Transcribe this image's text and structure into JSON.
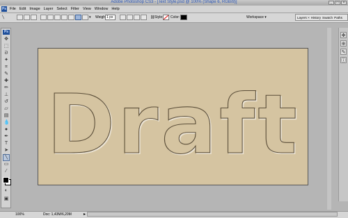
{
  "window": {
    "title": "Adobe Photoshop CS3 - [Text Style.psd @ 100% (Shape 6, RGB/8)]"
  },
  "menu": {
    "logo": "Ps",
    "items": [
      "File",
      "Edit",
      "Image",
      "Layer",
      "Select",
      "Filter",
      "View",
      "Window",
      "Help"
    ]
  },
  "options": {
    "weight_label": "Weight:",
    "weight_value": "1 px",
    "style_label": "Style:",
    "workspace_label": "Workspace ▾"
  },
  "palette_well": {
    "tabs": [
      "Layers ×",
      "History",
      "Swatch",
      "Paths"
    ]
  },
  "toolbox": {
    "badge": "Ps"
  },
  "canvas": {
    "text": "Draft"
  },
  "status": {
    "zoom": "100%",
    "doc": "Doc: 1,43M/6,20M",
    "arrow": "▸"
  },
  "colors": {
    "canvas_bg": "#d5c4a1",
    "workspace_bg": "#b5b5b5",
    "foreground": "#000000",
    "background": "#ffffff"
  }
}
